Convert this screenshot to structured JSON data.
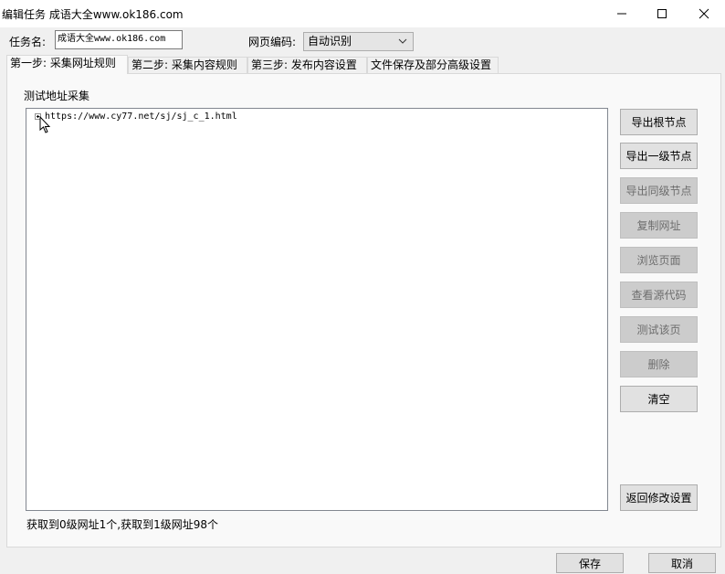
{
  "window": {
    "title": "编辑任务 成语大全www.ok186.com"
  },
  "form": {
    "task_name_label": "任务名:",
    "task_name_value": "成语大全www.ok186.com",
    "encoding_label": "网页编码:",
    "encoding_value": "自动识别"
  },
  "tabs": [
    {
      "label": "第一步: 采集网址规则"
    },
    {
      "label": "第二步: 采集内容规则"
    },
    {
      "label": "第三步: 发布内容设置"
    },
    {
      "label": "文件保存及部分高级设置"
    }
  ],
  "section": {
    "title": "测试地址采集"
  },
  "tree": {
    "nodes": [
      {
        "text": "https://www.cy77.net/sj/sj_c_1.html"
      }
    ]
  },
  "buttons": {
    "export_root": "导出根节点",
    "export_level1": "导出一级节点",
    "export_sibling": "导出同级节点",
    "copy_url": "复制网址",
    "browse_page": "浏览页面",
    "view_source": "查看源代码",
    "test_page": "测试该页",
    "delete": "删除",
    "clear": "清空",
    "back_to_settings": "返回修改设置",
    "save": "保存",
    "cancel": "取消"
  },
  "status": {
    "text": "获取到0级网址1个,获取到1级网址98个"
  }
}
